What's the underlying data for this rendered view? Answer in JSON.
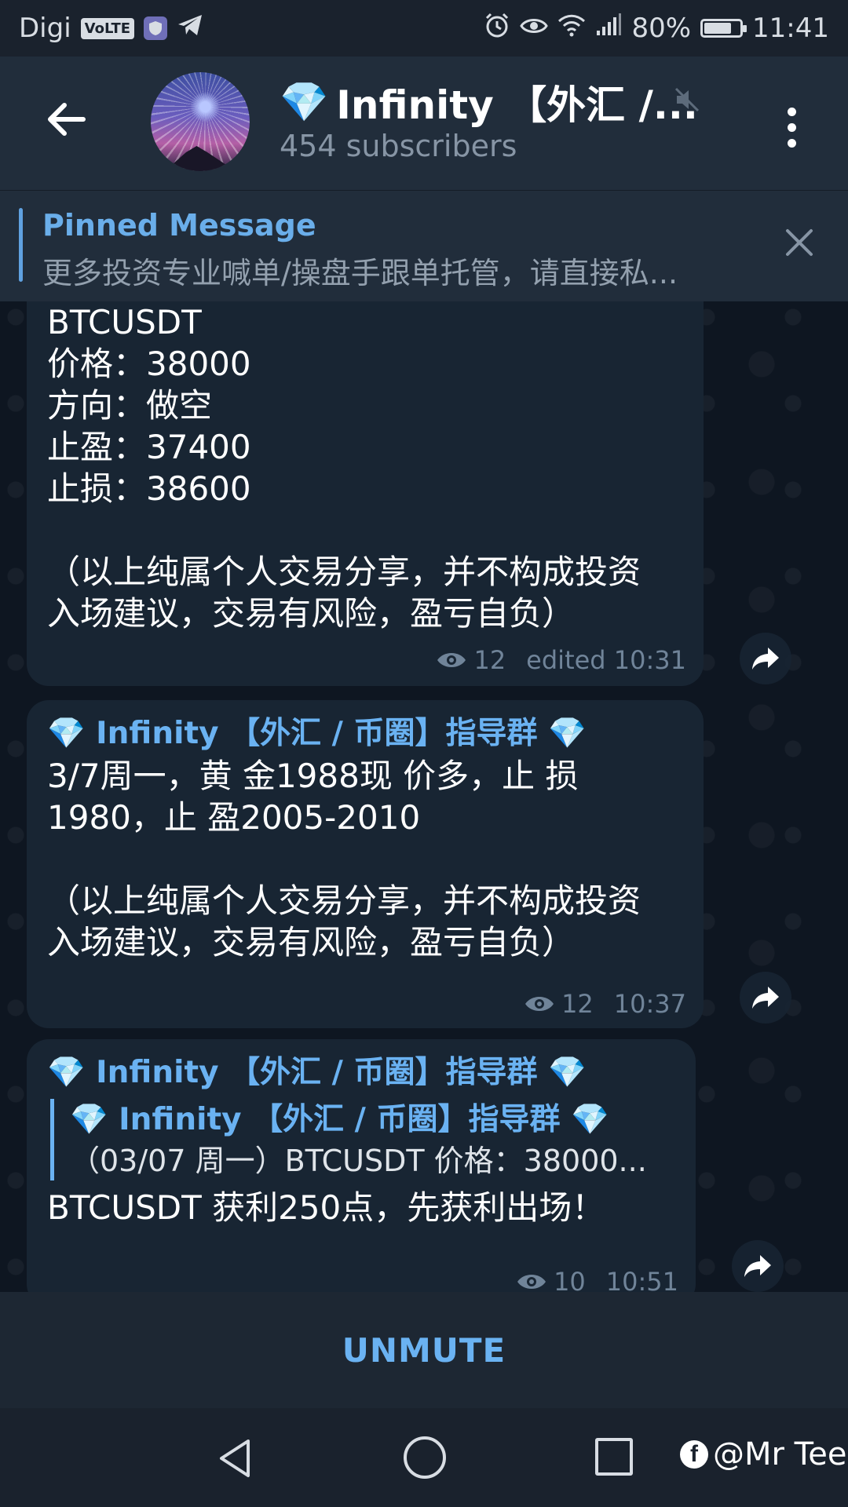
{
  "status_bar": {
    "carrier": "Digi",
    "volte": "VoLTE",
    "battery_percent": "80%",
    "battery_level": 0.8,
    "time": "11:41",
    "icons": [
      "shield-icon",
      "telegram-icon",
      "alarm-icon",
      "eye-icon",
      "wifi-icon",
      "signal-icon",
      "battery-icon"
    ]
  },
  "header": {
    "diamond": "💎",
    "title": "Infinity 【外汇 /...",
    "subtitle": "454 subscribers"
  },
  "pinned": {
    "title": "Pinned Message",
    "text": "更多投资专业喊单/操盘手跟单托管，请直接私..."
  },
  "messages": [
    {
      "lines": [
        "BTCUSDT",
        "价格：38000",
        "方向：做空",
        "止盈：37400",
        "止损：38600"
      ],
      "disclaimer": [
        "（以上纯属个人交易分享，并不构成投资",
        "入场建议，交易有风险，盈亏自负）"
      ],
      "views": "12",
      "time": "edited 10:31"
    },
    {
      "sender": "💎 Infinity 【外汇 / 币圈】指导群 💎",
      "lines": [
        "3/7周一，黄 金1988现 价多，止 损",
        "1980，止 盈2005-2010"
      ],
      "disclaimer": [
        "（以上纯属个人交易分享，并不构成投资",
        "入场建议，交易有风险，盈亏自负）"
      ],
      "views": "12",
      "time": "10:37"
    },
    {
      "sender": "💎 Infinity 【外汇 / 币圈】指导群 💎",
      "quote_sender": "💎 Infinity 【外汇 / 币圈】指导群 💎",
      "quote_text": "（03/07 周一）BTCUSDT 价格：38000...",
      "lines": [
        "BTCUSDT 获利250点，先获利出场！"
      ],
      "views": "10",
      "time": "10:51"
    }
  ],
  "unmute_label": "UNMUTE",
  "watermark": {
    "fb": "f",
    "text": "@Mr Tee"
  },
  "colors": {
    "accent": "#6ab2f2",
    "bubble": "#182533",
    "header": "#212d3b",
    "chat_bg": "#0e1621"
  }
}
